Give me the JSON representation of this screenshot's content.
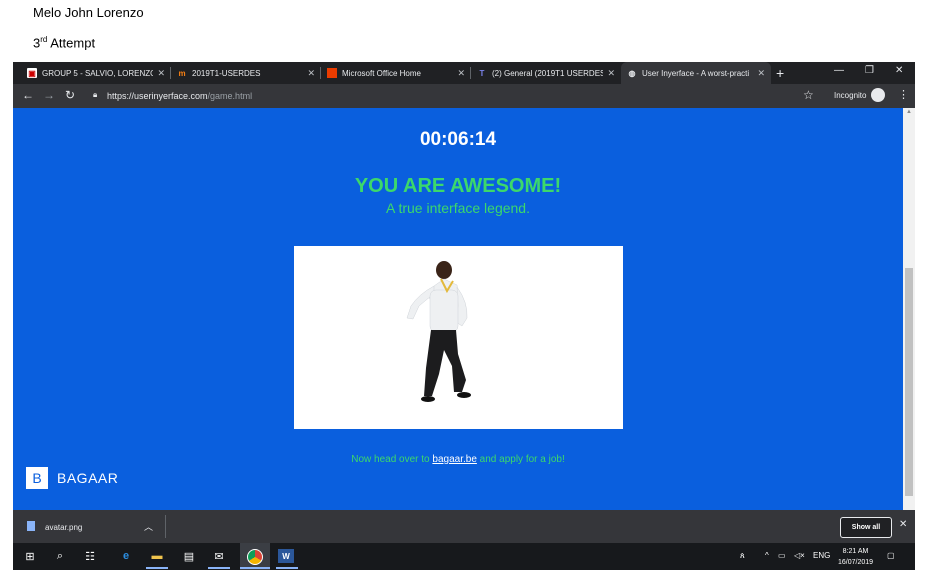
{
  "doc": {
    "author": "Melo John Lorenzo",
    "attempt_num": "3",
    "attempt_sup": "rd",
    "attempt_word": " Attempt"
  },
  "browser": {
    "tabs": [
      {
        "title": "GROUP 5 - SALVIO, LORENZO,",
        "icon": "document-icon",
        "active": false
      },
      {
        "title": "2019T1-USERDES",
        "icon": "moodle-icon",
        "active": false
      },
      {
        "title": "Microsoft Office Home",
        "icon": "office-icon",
        "active": false
      },
      {
        "title": "(2) General (2019T1 USERDES -",
        "icon": "teams-icon",
        "active": false
      },
      {
        "title": "User Inyerface - A worst-practi",
        "icon": "globe-icon",
        "active": true
      }
    ],
    "url_host": "https://userinyerface.com",
    "url_path": "/game.html",
    "incognito_label": "Incognito"
  },
  "page": {
    "timer": "00:06:14",
    "headline": "YOU ARE AWESOME!",
    "subheadline": "A true interface legend.",
    "footer_pre": "Now head over to ",
    "footer_link": "bagaar.be",
    "footer_post": " and apply for a job!",
    "brand_letter": "B",
    "brand_name": "BAGAAR"
  },
  "downloads": {
    "file_name": "avatar.png",
    "show_all_label": "Show all"
  },
  "taskbar": {
    "language": "ENG",
    "time": "8:21 AM",
    "date": "16/07/2019"
  },
  "colors": {
    "page_bg": "#0a5fde",
    "accent_green": "#3cd86b",
    "chrome_dark": "#202124"
  }
}
